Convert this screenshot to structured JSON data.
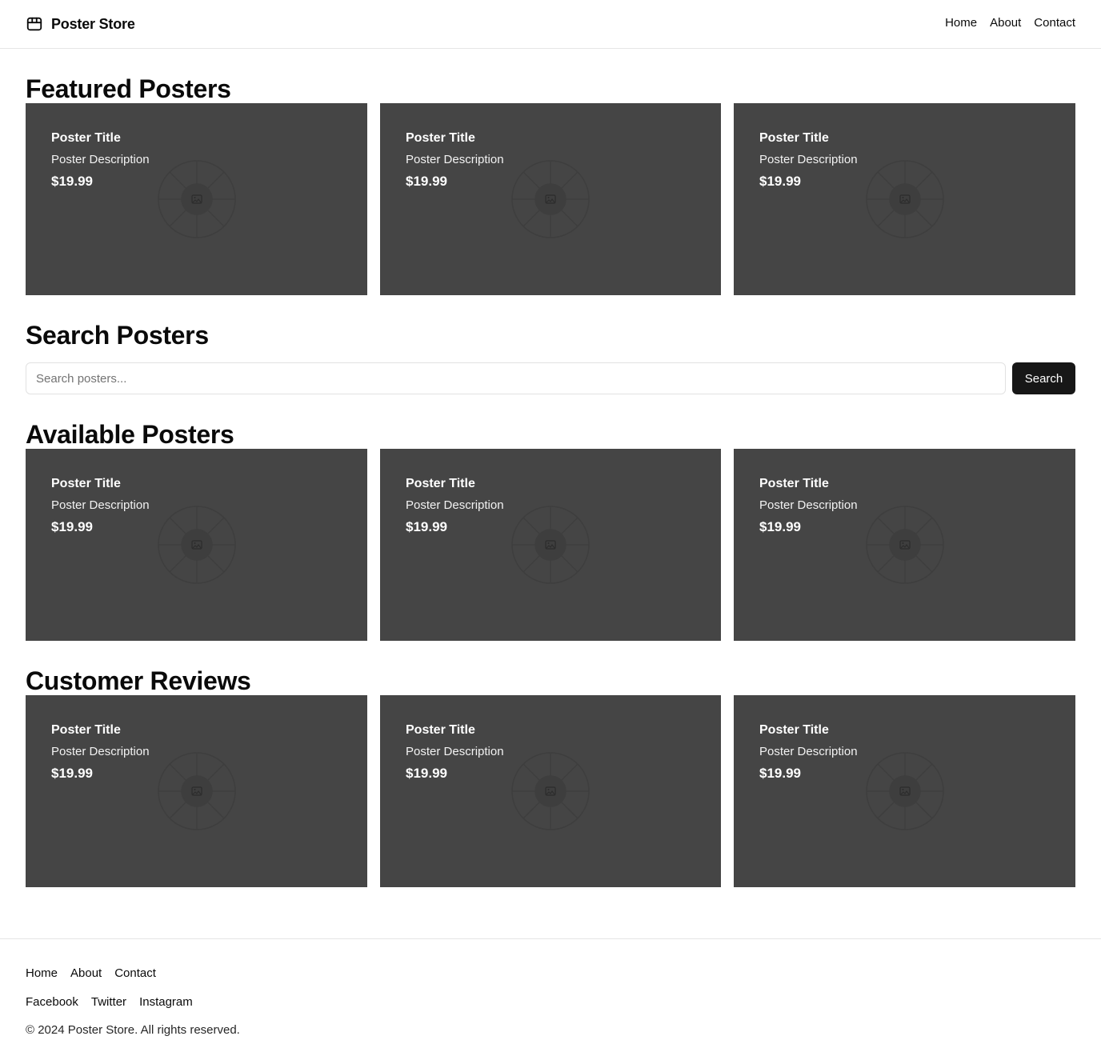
{
  "header": {
    "brand": "Poster Store",
    "nav": [
      "Home",
      "About",
      "Contact"
    ]
  },
  "sections": {
    "featured": {
      "title": "Featured Posters",
      "cards": [
        {
          "title": "Poster Title",
          "description": "Poster Description",
          "price": "$19.99"
        },
        {
          "title": "Poster Title",
          "description": "Poster Description",
          "price": "$19.99"
        },
        {
          "title": "Poster Title",
          "description": "Poster Description",
          "price": "$19.99"
        }
      ]
    },
    "search": {
      "title": "Search Posters",
      "placeholder": "Search posters...",
      "button": "Search"
    },
    "available": {
      "title": "Available Posters",
      "cards": [
        {
          "title": "Poster Title",
          "description": "Poster Description",
          "price": "$19.99"
        },
        {
          "title": "Poster Title",
          "description": "Poster Description",
          "price": "$19.99"
        },
        {
          "title": "Poster Title",
          "description": "Poster Description",
          "price": "$19.99"
        }
      ]
    },
    "reviews": {
      "title": "Customer Reviews",
      "cards": [
        {
          "title": "Poster Title",
          "description": "Poster Description",
          "price": "$19.99"
        },
        {
          "title": "Poster Title",
          "description": "Poster Description",
          "price": "$19.99"
        },
        {
          "title": "Poster Title",
          "description": "Poster Description",
          "price": "$19.99"
        }
      ]
    }
  },
  "footer": {
    "links": [
      "Home",
      "About",
      "Contact"
    ],
    "social": [
      "Facebook",
      "Twitter",
      "Instagram"
    ],
    "copyright": "© 2024 Poster Store. All rights reserved."
  },
  "colors": {
    "card_background": "#454545",
    "button_background": "#171717",
    "border": "#e5e5e5"
  },
  "icons": {
    "brand": "package-icon",
    "card_placeholder": "image-placeholder-icon"
  }
}
